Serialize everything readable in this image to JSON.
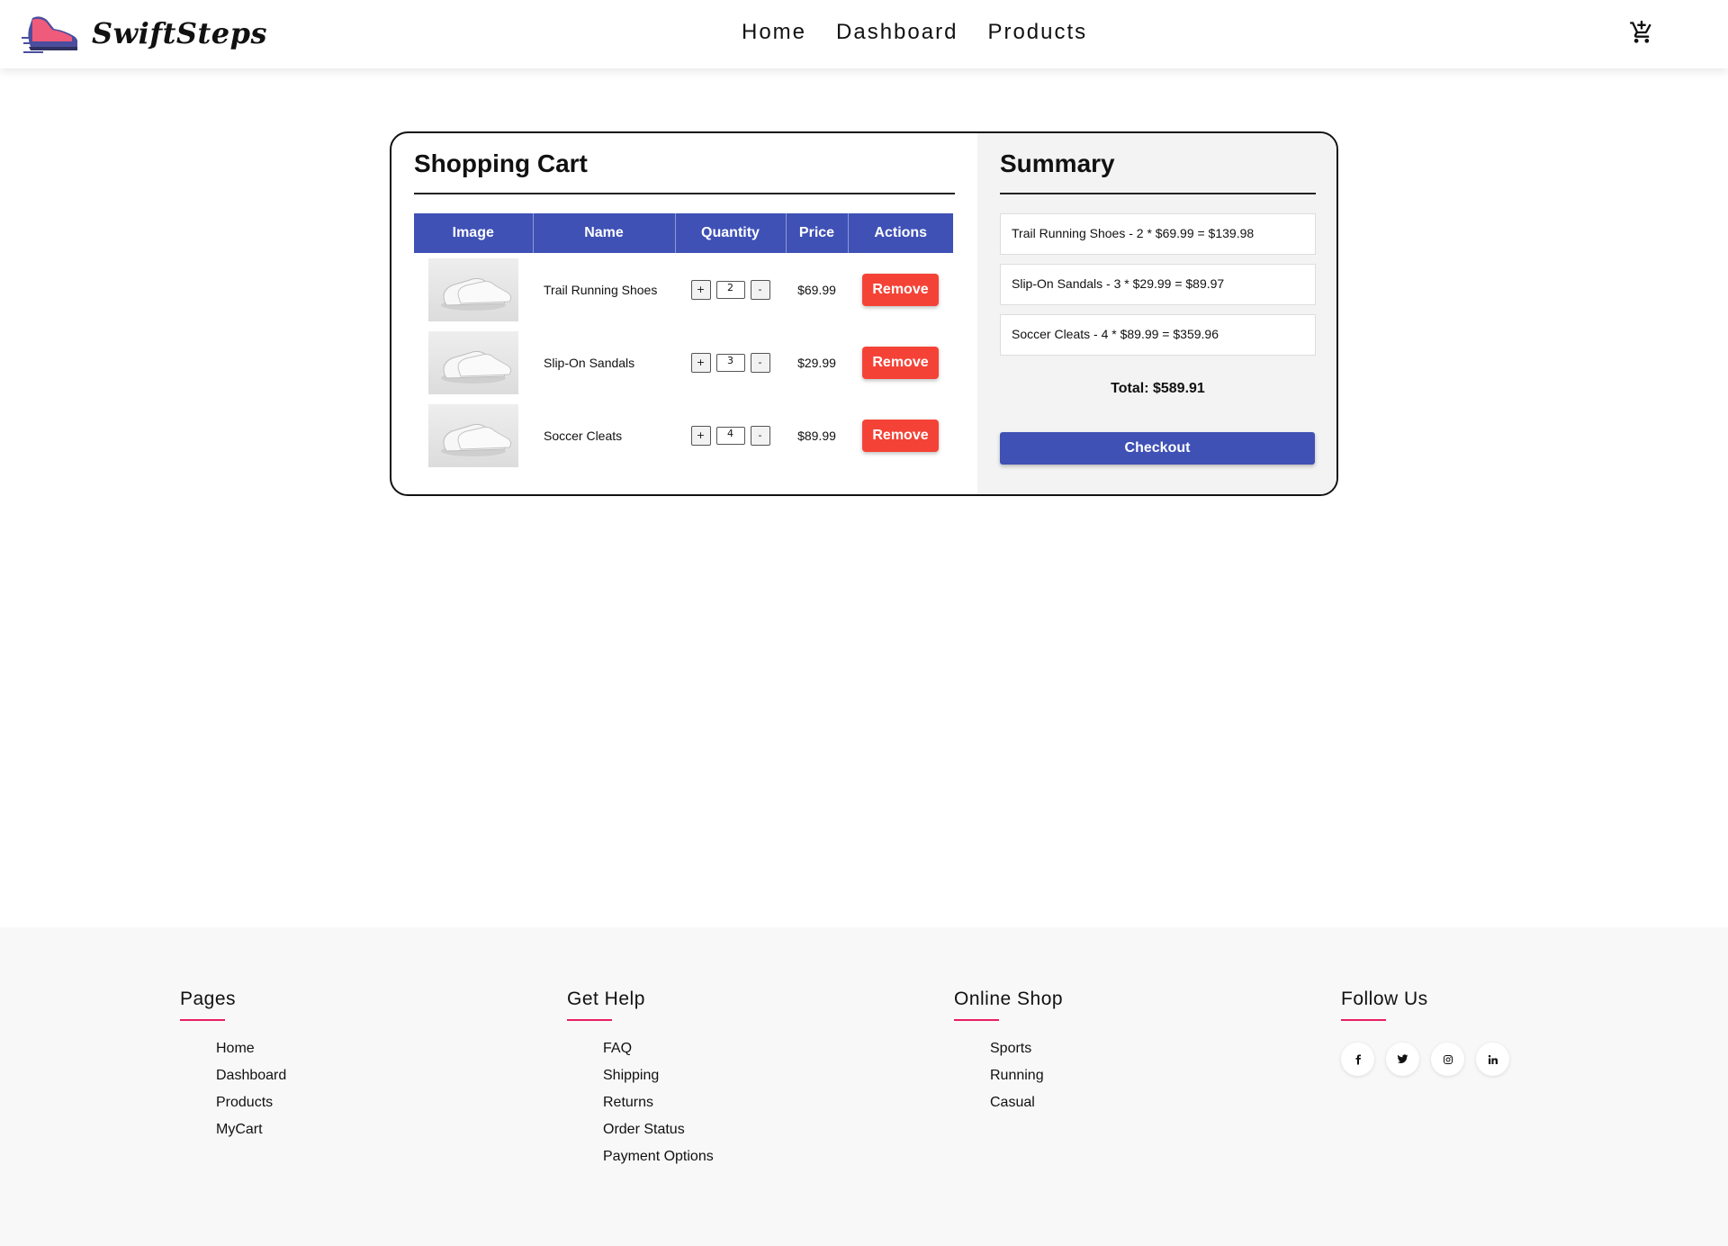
{
  "brand": {
    "name": "SwiftSteps",
    "logo_icon": "sneaker-logo-icon"
  },
  "nav": {
    "items": [
      "Home",
      "Dashboard",
      "Products"
    ],
    "cart_icon": "cart-plus-icon"
  },
  "cart": {
    "title": "Shopping Cart",
    "columns": [
      "Image",
      "Name",
      "Quantity",
      "Price",
      "Actions"
    ],
    "items": [
      {
        "name": "Trail Running Shoes",
        "quantity": "2",
        "price": "$69.99",
        "action": "Remove",
        "plus": "+",
        "minus": "-"
      },
      {
        "name": "Slip-On Sandals",
        "quantity": "3",
        "price": "$29.99",
        "action": "Remove",
        "plus": "+",
        "minus": "-"
      },
      {
        "name": "Soccer Cleats",
        "quantity": "4",
        "price": "$89.99",
        "action": "Remove",
        "plus": "+",
        "minus": "-"
      }
    ]
  },
  "summary": {
    "title": "Summary",
    "lines": [
      "Trail Running Shoes - 2 * $69.99 = $139.98",
      "Slip-On Sandals - 3 * $29.99 = $89.97",
      "Soccer Cleats - 4 * $89.99 = $359.96"
    ],
    "total": "Total: $589.91",
    "checkout": "Checkout"
  },
  "footer": {
    "pages": {
      "title": "Pages",
      "links": [
        "Home",
        "Dashboard",
        "Products",
        "MyCart"
      ]
    },
    "help": {
      "title": "Get Help",
      "links": [
        "FAQ",
        "Shipping",
        "Returns",
        "Order Status",
        "Payment Options"
      ]
    },
    "shop": {
      "title": "Online Shop",
      "links": [
        "Sports",
        "Running",
        "Casual"
      ]
    },
    "follow": {
      "title": "Follow Us",
      "icons": [
        "facebook-icon",
        "twitter-icon",
        "instagram-icon",
        "linkedin-icon"
      ]
    }
  },
  "colors": {
    "primary": "#3f51b5",
    "danger": "#f44336",
    "accent": "#e91e63"
  }
}
